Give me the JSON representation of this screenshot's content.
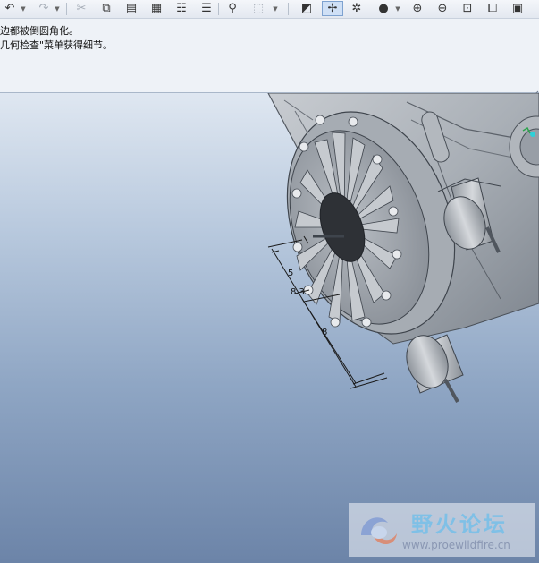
{
  "toolbar": {
    "buttons": [
      {
        "name": "undo-icon",
        "glyph": "↶"
      },
      {
        "name": "redo-icon",
        "glyph": "↷"
      },
      {
        "name": "cut-icon",
        "glyph": "✂"
      },
      {
        "name": "copy-icon",
        "glyph": "⧉"
      },
      {
        "name": "paste-icon",
        "glyph": "▤"
      },
      {
        "name": "paste-special-icon",
        "glyph": "▦"
      },
      {
        "name": "regenerate-icon",
        "glyph": "☷"
      },
      {
        "name": "regenerate-manager-icon",
        "glyph": "☰"
      },
      {
        "name": "find-icon",
        "glyph": "⚲"
      },
      {
        "name": "select-box-icon",
        "glyph": "⬚"
      },
      {
        "name": "datum-display-icon",
        "glyph": "◩"
      },
      {
        "name": "spin-center-icon",
        "glyph": "✢"
      },
      {
        "name": "orient-mode-icon",
        "glyph": "✲"
      },
      {
        "name": "display-style-icon",
        "glyph": "●"
      },
      {
        "name": "zoom-in-icon",
        "glyph": "⊕"
      },
      {
        "name": "zoom-out-icon",
        "glyph": "⊖"
      },
      {
        "name": "refit-icon",
        "glyph": "⊡"
      },
      {
        "name": "saved-views-icon",
        "glyph": "⧠"
      },
      {
        "name": "repaint-icon",
        "glyph": "▣"
      }
    ]
  },
  "message_area": {
    "lines": [
      "边都被倒圆角化。",
      "几何检查\"菜单获得细节。"
    ]
  },
  "dimensions": {
    "d1": "5",
    "d2": "8.3",
    "d3": "8"
  },
  "watermark": {
    "title": "野火论坛",
    "url": "www.proewildfire.cn"
  }
}
